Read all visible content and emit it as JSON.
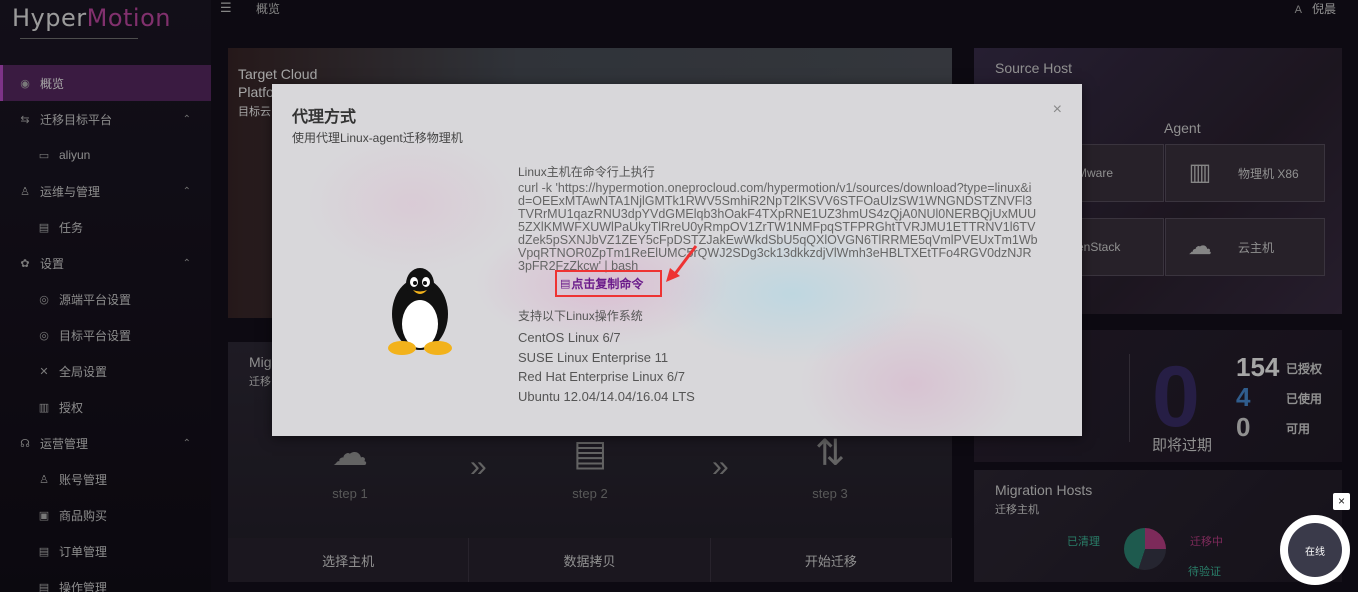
{
  "app": {
    "logo_prefix": "Hyper",
    "logo_accent": "Motion",
    "breadcrumb": "概览",
    "user": "倪晨",
    "lang_icon": "language-icon"
  },
  "sidebar": {
    "items": [
      {
        "label": "概览",
        "icon": "dashboard-icon",
        "level": "top",
        "active": true
      },
      {
        "label": "迁移目标平台",
        "icon": "migrate-icon",
        "level": "top",
        "caret": "^"
      },
      {
        "label": "aliyun",
        "icon": "folder-icon",
        "level": "sub"
      },
      {
        "label": "运维与管理",
        "icon": "user-icon",
        "level": "top",
        "caret": "^"
      },
      {
        "label": "任务",
        "icon": "task-icon",
        "level": "sub"
      },
      {
        "label": "设置",
        "icon": "gear-icon",
        "level": "top",
        "caret": "^"
      },
      {
        "label": "源端平台设置",
        "icon": "settings-icon",
        "level": "sub"
      },
      {
        "label": "目标平台设置",
        "icon": "settings-icon",
        "level": "sub"
      },
      {
        "label": "全局设置",
        "icon": "tools-icon",
        "level": "sub"
      },
      {
        "label": "授权",
        "icon": "license-icon",
        "level": "sub"
      },
      {
        "label": "运营管理",
        "icon": "operations-icon",
        "level": "top",
        "caret": "^"
      },
      {
        "label": "账号管理",
        "icon": "account-icon",
        "level": "sub"
      },
      {
        "label": "商品购买",
        "icon": "cart-icon",
        "level": "sub"
      },
      {
        "label": "订单管理",
        "icon": "order-icon",
        "level": "sub"
      },
      {
        "label": "操作管理",
        "icon": "log-icon",
        "level": "sub"
      }
    ]
  },
  "target_panel": {
    "title_line1": "Target Cloud",
    "title_line2": "Platfo",
    "subtitle": "目标云"
  },
  "source_panel": {
    "title": "Source Host",
    "agent_label": "Agent",
    "tiles": [
      {
        "label": "Mware",
        "icon": "vmware-icon"
      },
      {
        "label": "物理机 X86",
        "icon": "server-icon"
      },
      {
        "label": "enStack",
        "icon": "openstack-icon"
      },
      {
        "label": "云主机",
        "icon": "cloud-host-icon"
      }
    ]
  },
  "migration_panel": {
    "title": "Mig",
    "subtitle": "迁移",
    "steps": [
      {
        "label": "step 1",
        "icon": "cloud-icon"
      },
      {
        "label": "step 2",
        "icon": "server-clock-icon"
      },
      {
        "label": "step 3",
        "icon": "cloud-transfer-icon"
      }
    ],
    "tabs": [
      "选择主机",
      "数据拷贝",
      "开始迁移"
    ]
  },
  "license_panel": {
    "expiring_count": "0",
    "expiring_label": "即将过期",
    "authorized_count": "154",
    "authorized_label": "已授权",
    "used_count": "4",
    "used_label": "已使用",
    "available_count": "0",
    "available_label": "可用"
  },
  "hosts_panel": {
    "title": "Migration Hosts",
    "subtitle": "迁移主机",
    "legend": [
      "已清理",
      "迁移中",
      "待验证"
    ]
  },
  "modal": {
    "title": "代理方式",
    "subtitle": "使用代理Linux-agent迁移物理机",
    "command_label": "Linux主机在命令行上执行",
    "command": "curl -k 'https://hypermotion.oneprocloud.com/hypermotion/v1/sources/download?type=linux&id=OEExMTAwNTA1NjlGMTk1RWV5SmhiR2NpT2lKSVV6STFOaUlzSW1WNGNDSTZNVFl3TVRrMU1qazRNU3dpYVdGMElqb3hOakF4TXpRNE1UZ3hmUS4zQjA0NUl0NERBQjUxMUU5ZXlKMWFXUWlPaUkyTlRreU0yRmpOV1ZrTW1NMFpqSTFPRGhtTVRJMU1ETTRNV1l6TVdZek5pSXNJbVZ1ZEY5cFpDSTZJakEwWkdSbU5qQXlOVGN6TlRRME5qVmlPVEUxTm1WbVpqRTNOR0ZpTm1ReElUMC5rQWJ2SDg3ck13dkkzdjVlWmh3eHBLTXEtTFo4RGV0dzNJR3pFR2FzZkcw' | bash",
    "copy_label": "点击复制命令",
    "os_label": "支持以下Linux操作系统",
    "os_list": [
      "CentOS Linux 6/7",
      "SUSE Linux Enterprise 11",
      "Red Hat Enterprise Linux 6/7",
      "Ubuntu 12.04/14.04/16.04 LTS"
    ],
    "close_symbol": "×"
  },
  "chat": {
    "label": "在线",
    "close_symbol": "×"
  },
  "colors": {
    "accent": "#c04fd0",
    "active_nav": "#5a2a64",
    "copy_border": "#e33333",
    "copy_text": "#6a1a8a",
    "authorized": "#ffffff",
    "used": "#4a90d9"
  }
}
